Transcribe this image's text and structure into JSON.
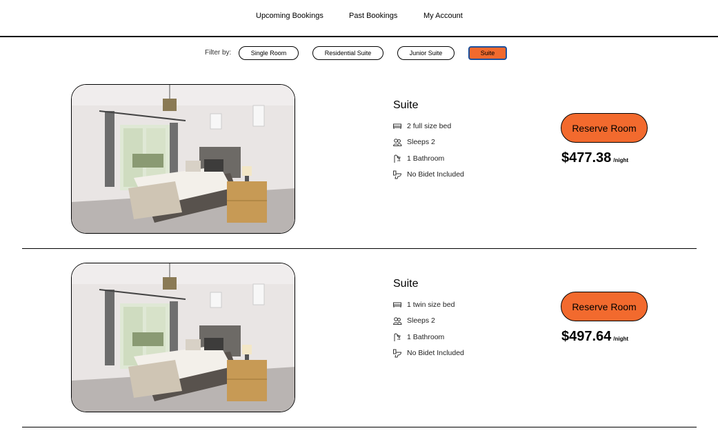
{
  "nav": {
    "links": [
      "Upcoming Bookings",
      "Past Bookings",
      "My Account"
    ]
  },
  "filter": {
    "label": "Filter by:",
    "options": [
      "Single Room",
      "Residential Suite",
      "Junior Suite",
      "Suite"
    ],
    "selected": "Suite"
  },
  "colors": {
    "accent": "#f26a2e",
    "selected_outline": "#1b4f9b"
  },
  "listings": [
    {
      "title": "Suite",
      "amenities": [
        {
          "icon": "bed-icon",
          "text": "2 full size bed"
        },
        {
          "icon": "people-icon",
          "text": "Sleeps 2"
        },
        {
          "icon": "shower-icon",
          "text": "1 Bathroom"
        },
        {
          "icon": "toilet-icon",
          "text": "No Bidet Included"
        }
      ],
      "reserve_label": "Reserve Room",
      "price": "$477.38",
      "price_unit": "/night"
    },
    {
      "title": "Suite",
      "amenities": [
        {
          "icon": "bed-icon",
          "text": "1 twin size bed"
        },
        {
          "icon": "people-icon",
          "text": "Sleeps 2"
        },
        {
          "icon": "shower-icon",
          "text": "1 Bathroom"
        },
        {
          "icon": "toilet-icon",
          "text": "No Bidet Included"
        }
      ],
      "reserve_label": "Reserve Room",
      "price": "$497.64",
      "price_unit": "/night"
    }
  ]
}
